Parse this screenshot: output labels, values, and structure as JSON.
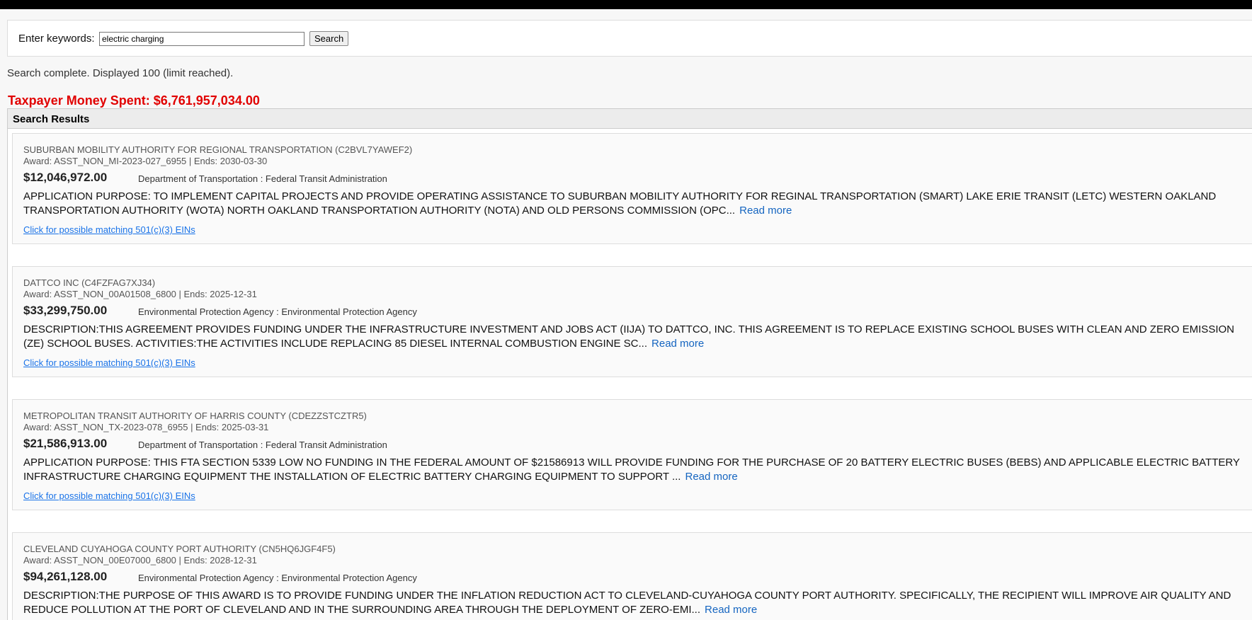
{
  "search": {
    "label": "Enter keywords:",
    "value": "electric charging",
    "button": "Search"
  },
  "status": "Search complete. Displayed 100 (limit reached).",
  "total_spent": "Taxpayer Money Spent: $6,761,957,034.00",
  "results_header": "Search Results",
  "read_more_label": "Read more",
  "ein_link_label": "Click for possible matching 501(c)(3) EINs",
  "results": [
    {
      "recipient": "SUBURBAN MOBILITY AUTHORITY FOR REGIONAL TRANSPORTATION (C2BVL7YAWEF2)",
      "award": "Award: ASST_NON_MI-2023-027_6955 | Ends: 2030-03-30",
      "amount": "$12,046,972.00",
      "agency": "Department of Transportation : Federal Transit Administration",
      "description": "APPLICATION PURPOSE: TO IMPLEMENT CAPITAL PROJECTS AND PROVIDE OPERATING ASSISTANCE TO SUBURBAN MOBILITY AUTHORITY FOR REGINAL TRANSPORTATION (SMART) LAKE ERIE TRANSIT (LETC) WESTERN OAKLAND TRANSPORTATION AUTHORITY (WOTA) NORTH OAKLAND TRANSPORTATION AUTHORITY (NOTA) AND OLD PERSONS COMMISSION (OPC..."
    },
    {
      "recipient": "DATTCO INC (C4FZFAG7XJ34)",
      "award": "Award: ASST_NON_00A01508_6800 | Ends: 2025-12-31",
      "amount": "$33,299,750.00",
      "agency": "Environmental Protection Agency : Environmental Protection Agency",
      "description": "DESCRIPTION:THIS AGREEMENT PROVIDES FUNDING UNDER THE INFRASTRUCTURE INVESTMENT AND JOBS ACT (IIJA) TO DATTCO, INC. THIS AGREEMENT IS TO REPLACE EXISTING SCHOOL BUSES WITH CLEAN AND ZERO EMISSION (ZE) SCHOOL BUSES. ACTIVITIES:THE ACTIVITIES INCLUDE REPLACING 85 DIESEL INTERNAL COMBUSTION ENGINE SC..."
    },
    {
      "recipient": "METROPOLITAN TRANSIT AUTHORITY OF HARRIS COUNTY (CDEZZSTCZTR5)",
      "award": "Award: ASST_NON_TX-2023-078_6955 | Ends: 2025-03-31",
      "amount": "$21,586,913.00",
      "agency": "Department of Transportation : Federal Transit Administration",
      "description": "APPLICATION PURPOSE: THIS FTA SECTION 5339 LOW NO FUNDING IN THE FEDERAL AMOUNT OF $21586913 WILL PROVIDE FUNDING FOR THE PURCHASE OF 20 BATTERY ELECTRIC BUSES (BEBS) AND APPLICABLE ELECTRIC BATTERY INFRASTRUCTURE CHARGING EQUIPMENT THE INSTALLATION OF ELECTRIC BATTERY CHARGING EQUIPMENT TO SUPPORT ..."
    },
    {
      "recipient": "CLEVELAND CUYAHOGA COUNTY PORT AUTHORITY (CN5HQ6JGF4F5)",
      "award": "Award: ASST_NON_00E07000_6800 | Ends: 2028-12-31",
      "amount": "$94,261,128.00",
      "agency": "Environmental Protection Agency : Environmental Protection Agency",
      "description": "DESCRIPTION:THE PURPOSE OF THIS AWARD IS TO PROVIDE FUNDING UNDER THE INFLATION REDUCTION ACT TO CLEVELAND-CUYAHOGA COUNTY PORT AUTHORITY. SPECIFICALLY, THE RECIPIENT WILL IMPROVE AIR QUALITY AND REDUCE POLLUTION AT THE PORT OF CLEVELAND AND IN THE SURROUNDING AREA THROUGH THE DEPLOYMENT OF ZERO-EMI..."
    }
  ]
}
